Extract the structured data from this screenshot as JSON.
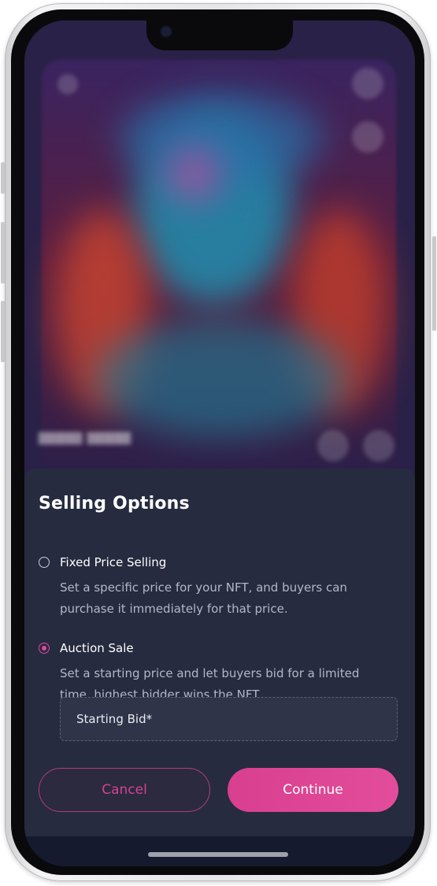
{
  "sheet": {
    "title": "Selling Options",
    "options": [
      {
        "label": "Fixed Price Selling",
        "description": "Set a specific price for your NFT, and buyers can purchase it immediately for that price.",
        "selected": false
      },
      {
        "label": "Auction Sale",
        "description": "Set a starting price and let buyers bid for a limited time, highest bidder wins the NFT.",
        "selected": true
      }
    ],
    "starting_bid_placeholder": "Starting Bid*",
    "cancel_label": "Cancel",
    "continue_label": "Continue"
  },
  "colors": {
    "accent": "#e0489a",
    "sheet_background": "#262b3f"
  }
}
